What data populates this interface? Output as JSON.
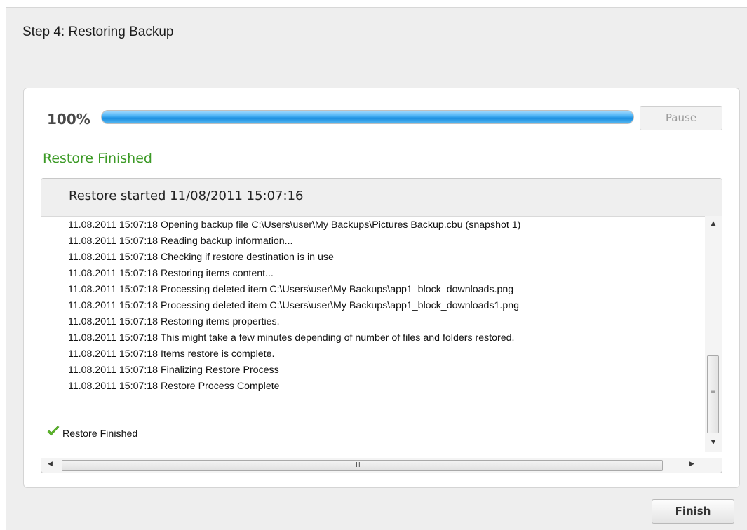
{
  "step_title": "Step 4: Restoring Backup",
  "progress": {
    "percent_label": "100%",
    "value": 1.0,
    "pause_label": "Pause"
  },
  "status_text": "Restore Finished",
  "log": {
    "header": "Restore started 11/08/2011 15:07:16",
    "lines": [
      "11.08.2011 15:07:18 Opening backup file C:\\Users\\user\\My Backups\\Pictures Backup.cbu (snapshot 1)",
      "11.08.2011 15:07:18 Reading backup information...",
      "11.08.2011 15:07:18 Checking if restore destination is in use",
      "11.08.2011 15:07:18 Restoring items content...",
      "11.08.2011 15:07:18 Processing deleted item C:\\Users\\user\\My Backups\\app1_block_downloads.png",
      "11.08.2011 15:07:18 Processing deleted item C:\\Users\\user\\My Backups\\app1_block_downloads1.png",
      "11.08.2011 15:07:18 Restoring items properties.",
      "11.08.2011 15:07:18 This might take a few minutes depending of number of files and folders restored.",
      "11.08.2011 15:07:18 Items restore is complete.",
      "11.08.2011 15:07:18 Finalizing Restore Process",
      "11.08.2011 15:07:18 Restore Process Complete"
    ],
    "final_line": "Restore Finished",
    "final_icon": "checkmark-icon"
  },
  "finish_label": "Finish",
  "colors": {
    "status_green": "#3c9a26",
    "progress_blue": "#2e9ee8",
    "check_green": "#5cb82a"
  }
}
